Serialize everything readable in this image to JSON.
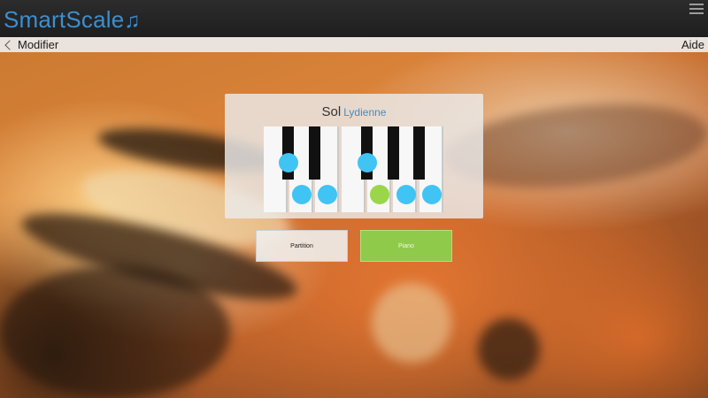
{
  "app": {
    "title": "SmartScale",
    "title_icon": "♫",
    "menu_icon": "hamburger-icon"
  },
  "nav": {
    "back_label": "Modifier",
    "help_label": "Aide"
  },
  "scale": {
    "root": "Sol",
    "mode": "Lydienne"
  },
  "piano": {
    "white_keys": 7,
    "black_keys": 5,
    "highlight_color": "#3fc4f4",
    "root_color": "#9bd64a"
  },
  "buttons": {
    "partition_label": "Partition",
    "piano_label": "Piano"
  },
  "colors": {
    "accent": "#3b8fd0",
    "piano_button": "#8fca4a"
  }
}
